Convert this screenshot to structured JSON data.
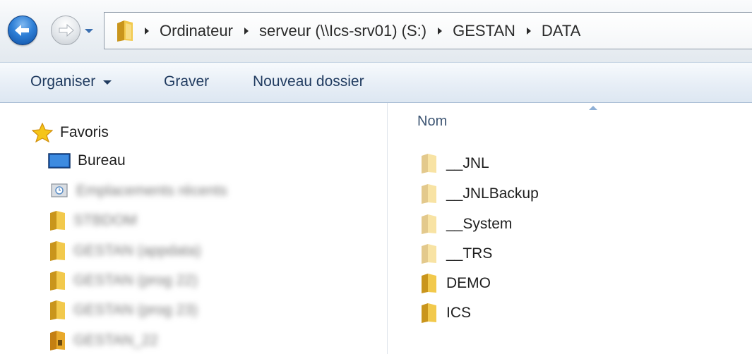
{
  "navigation": {
    "back_icon": "back-arrow-icon",
    "forward_icon": "forward-arrow-icon",
    "history_icon": "chevron-down-icon"
  },
  "address_bar": {
    "folder_icon": "folder-icon",
    "breadcrumbs": [
      "Ordinateur",
      "serveur (\\\\Ics-srv01) (S:)",
      "GESTAN",
      "DATA"
    ]
  },
  "toolbar": {
    "organise_label": "Organiser",
    "burn_label": "Graver",
    "new_folder_label": "Nouveau dossier"
  },
  "nav_pane": {
    "favorites_label": "Favoris",
    "desktop_label": "Bureau",
    "blurred_items": [
      {
        "label": "Emplacements récents",
        "icon": "recent-places-icon"
      },
      {
        "label": "STBDOM",
        "icon": "folder-icon"
      },
      {
        "label": "GESTAN (appdata)",
        "icon": "folder-icon"
      },
      {
        "label": "GESTAN (prog 22)",
        "icon": "folder-icon"
      },
      {
        "label": "GESTAN (prog 23)",
        "icon": "folder-icon"
      },
      {
        "label": "GESTAN_22",
        "icon": "zip-folder-icon"
      }
    ]
  },
  "content": {
    "column_header": "Nom",
    "files": [
      {
        "name": "__JNL",
        "hidden": true
      },
      {
        "name": "__JNLBackup",
        "hidden": true
      },
      {
        "name": "__System",
        "hidden": true
      },
      {
        "name": "__TRS",
        "hidden": true
      },
      {
        "name": "DEMO",
        "hidden": false
      },
      {
        "name": "ICS",
        "hidden": false
      }
    ]
  },
  "colors": {
    "toolbar_text": "#1f3a5f",
    "folder_yellow": "#e8b92e",
    "back_button_blue": "#2e7fd6"
  }
}
